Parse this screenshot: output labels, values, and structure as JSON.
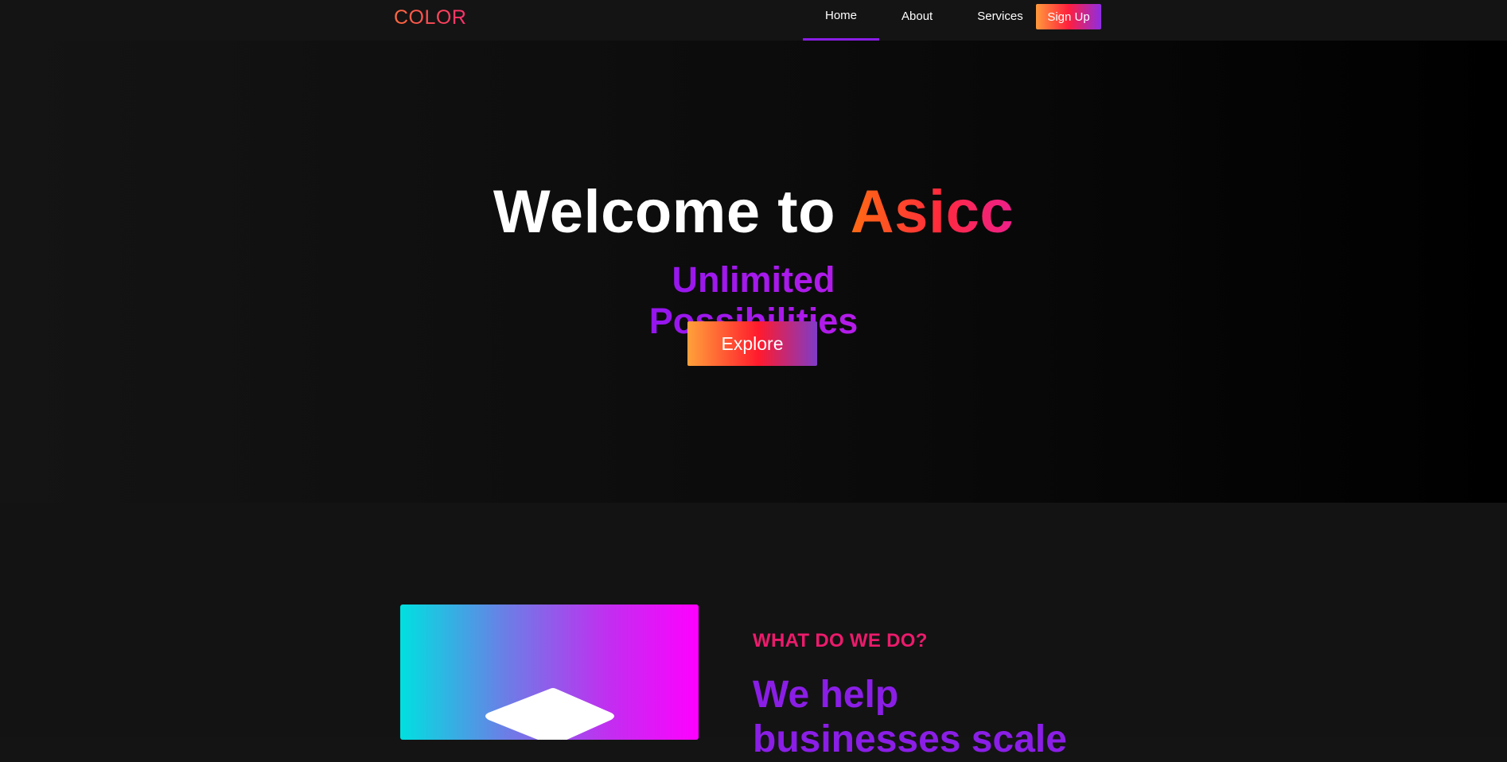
{
  "nav": {
    "logo": "COLOR",
    "links": [
      {
        "label": "Home",
        "active": true
      },
      {
        "label": "About",
        "active": false
      },
      {
        "label": "Services",
        "active": false
      }
    ],
    "signup_label": "Sign Up"
  },
  "hero": {
    "title_prefix": "Welcome to ",
    "title_brand": "Asicc",
    "subtitle": "Unlimited Possibilities",
    "cta_label": "Explore"
  },
  "about": {
    "eyebrow": "WHAT DO WE DO?",
    "heading": "We help businesses scale"
  },
  "colors": {
    "accent_purple": "#8a1ee6",
    "accent_pink": "#ec1b6c",
    "accent_orange": "#ff6a13",
    "background": "#141414"
  }
}
